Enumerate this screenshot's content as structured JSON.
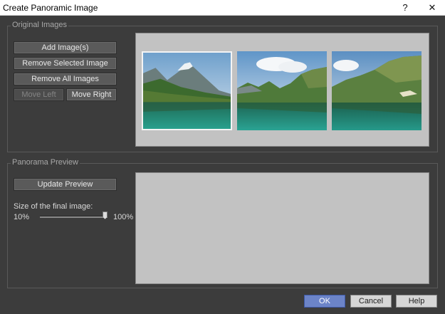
{
  "window": {
    "title": "Create Panoramic Image",
    "help_glyph": "?",
    "close_glyph": "✕"
  },
  "original_images": {
    "label": "Original Images",
    "add_label": "Add Image(s)",
    "remove_selected_label": "Remove Selected Image",
    "remove_all_label": "Remove All Images",
    "move_left_label": "Move Left",
    "move_right_label": "Move Right"
  },
  "panorama_preview": {
    "label": "Panorama Preview",
    "update_label": "Update Preview",
    "size_label": "Size of the final image:",
    "min_label": "10%",
    "max_label": "100%",
    "size_fraction": 1.0
  },
  "footer": {
    "ok_label": "OK",
    "cancel_label": "Cancel",
    "help_label": "Help"
  },
  "colors": {
    "background": "#3c3c3c",
    "preview_bg": "#c2c2c2",
    "ok_button": "#6c84c8"
  }
}
